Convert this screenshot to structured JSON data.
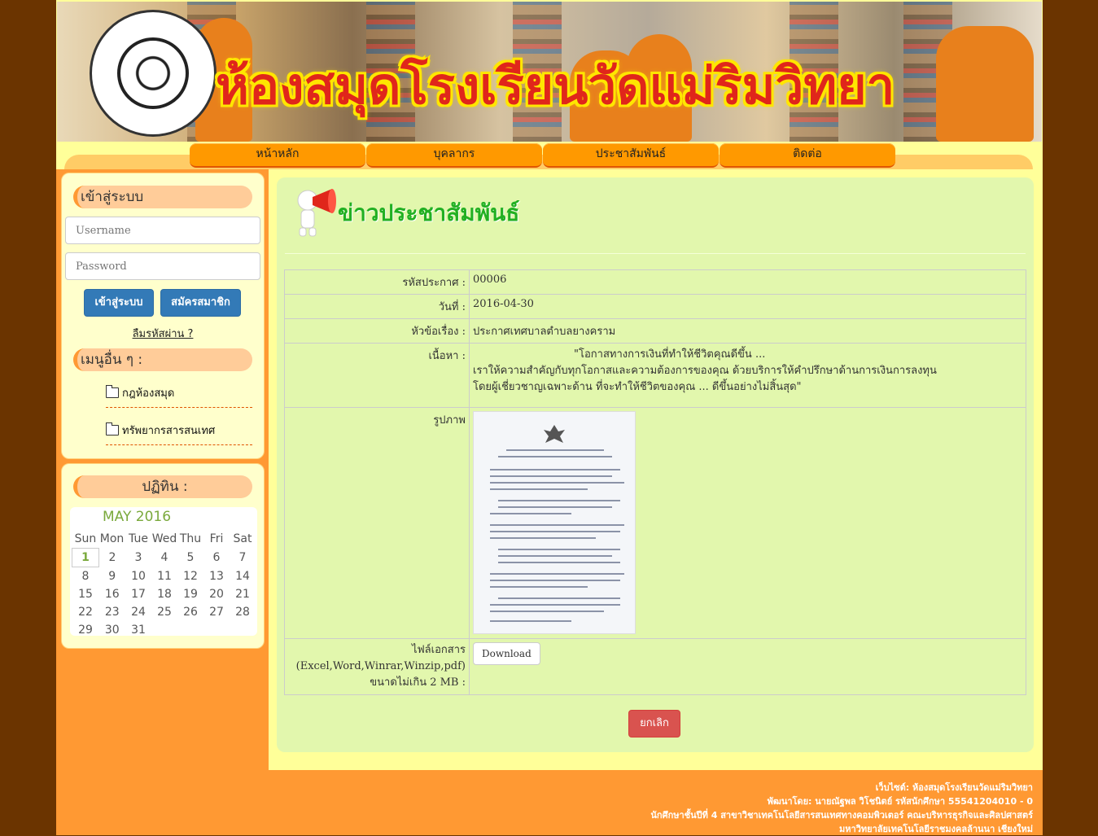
{
  "banner": {
    "title": "ห้องสมุดโรงเรียนวัดแม่ริมวิทยา"
  },
  "nav": {
    "items": [
      {
        "label": "หน้าหลัก"
      },
      {
        "label": "บุคลากร"
      },
      {
        "label": "ประชาสัมพันธ์"
      },
      {
        "label": "ติดต่อ"
      }
    ]
  },
  "login": {
    "heading": "เข้าสู่ระบบ",
    "username_placeholder": "Username",
    "password_placeholder": "Password",
    "login_button": "เข้าสู่ระบบ",
    "register_button": "สมัครสมาชิก",
    "forgot_link": "ลืมรหัสผ่าน ?"
  },
  "menu": {
    "heading": "เมนูอื่น ๆ :",
    "items": [
      {
        "label": "กฎห้องสมุด"
      },
      {
        "label": "ทรัพยากรสารสนเทศ"
      }
    ]
  },
  "calendar": {
    "heading": "ปฏิทิน :",
    "month": "MAY 2016",
    "weekdays": [
      "Sun",
      "Mon",
      "Tue",
      "Wed",
      "Thu",
      "Fri",
      "Sat"
    ],
    "weeks": [
      [
        "1",
        "2",
        "3",
        "4",
        "5",
        "6",
        "7"
      ],
      [
        "8",
        "9",
        "10",
        "11",
        "12",
        "13",
        "14"
      ],
      [
        "15",
        "16",
        "17",
        "18",
        "19",
        "20",
        "21"
      ],
      [
        "22",
        "23",
        "24",
        "25",
        "26",
        "27",
        "28"
      ],
      [
        "29",
        "30",
        "31",
        "",
        "",
        "",
        ""
      ]
    ],
    "today": "1"
  },
  "main": {
    "title": "ข่าวประชาสัมพันธ์",
    "rows": {
      "id_label": "รหัสประกาศ :",
      "id_value": "00006",
      "date_label": "วันที่ :",
      "date_value": "2016-04-30",
      "subject_label": "หัวข้อเรื่อง :",
      "subject_value": "ประกาศเทศบาลตำบลยางคราม",
      "content_label": "เนื้อหา :",
      "content_line1": "\"โอกาสทางการเงินที่ทำให้ชีวิตคุณดีขึ้น ...",
      "content_line2": "เราให้ความสำคัญกับทุกโอกาสและความต้องการของคุณ ด้วยบริการให้คำปรึกษาด้านการเงินการลงทุน",
      "content_line3": "โดยผู้เชี่ยวชาญเฉพาะด้าน ที่จะทำให้ชีวิตของคุณ ... ดีขึ้นอย่างไม่สิ้นสุด\"",
      "image_label": "รูปภาพ",
      "file_label_1": "ไฟล์เอกสาร",
      "file_label_2": "(Excel,Word,Winrar,Winzip,pdf)",
      "file_label_3": "ขนาดไม่เกิน 2 MB :",
      "download_button": "Download"
    },
    "cancel_button": "ยกเลิก"
  },
  "footer": {
    "line1": "เว็บไซต์: ห้องสมุดโรงเรียนวัดแม่ริมวิทยา",
    "line2": "พัฒนาโดย: นายณัฐพล วิโชนิตย์ รหัสนักศึกษา 55541204010 - 0",
    "line3": "นักศึกษาชั้นปีที่ 4 สาขาวิชาเทคโนโลยีสารสนเทศทางคอมพิวเตอร์ คณะบริหารธุรกิจและศิลปศาสตร์",
    "line4": "มหาวิทยาลัยเทคโนโลยีราชมงคลล้านนา เชียงใหม่"
  },
  "colors": {
    "page_bg": "#6b3400",
    "nav_button": "#ff9900",
    "panel_bg": "#e2f7ad",
    "title_green": "#22b022",
    "footer_bg": "#ff9933"
  }
}
